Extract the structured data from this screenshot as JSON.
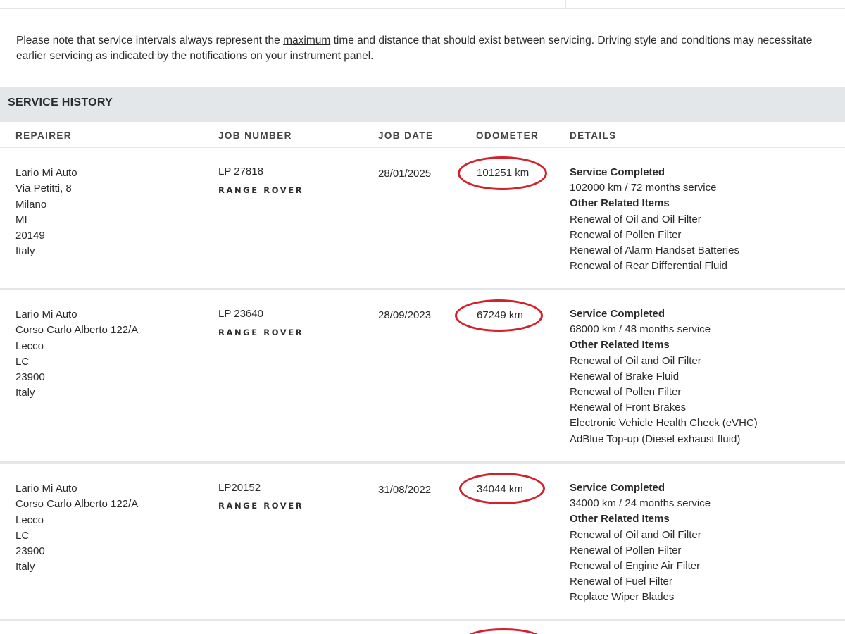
{
  "note": {
    "before": "Please note that service intervals always represent the ",
    "emph": "maximum",
    "after": " time and distance that should exist between servicing. Driving style and conditions may necessitate earlier servicing as indicated by the notifications on your instrument panel."
  },
  "section_title": "SERVICE HISTORY",
  "columns": {
    "repairer": "REPAIRER",
    "job_number": "JOB NUMBER",
    "job_date": "JOB DATE",
    "odometer": "ODOMETER",
    "details": "DETAILS"
  },
  "colors": {
    "highlight_ring": "#d4202a",
    "header_bg": "#e4e7e9"
  },
  "records": [
    {
      "repairer": [
        "Lario Mi Auto",
        "Via Petitti, 8",
        "Milano",
        "MI",
        "20149",
        "Italy"
      ],
      "job_number": "LP 27818",
      "brand": "RANGE ROVER",
      "job_date": "28/01/2025",
      "odometer": "101251 km",
      "details": {
        "heading": "Service Completed",
        "service": "102000 km / 72 months service",
        "other_heading": "Other Related Items",
        "items": [
          "Renewal of Oil and Oil Filter",
          "Renewal of Pollen Filter",
          "Renewal of Alarm Handset Batteries",
          "Renewal of Rear Differential Fluid"
        ]
      }
    },
    {
      "repairer": [
        "Lario Mi Auto",
        "Corso Carlo Alberto 122/A",
        "Lecco",
        "LC",
        "23900",
        "Italy"
      ],
      "job_number": "LP 23640",
      "brand": "RANGE ROVER",
      "job_date": "28/09/2023",
      "odometer": "67249 km",
      "details": {
        "heading": "Service Completed",
        "service": "68000 km / 48 months service",
        "other_heading": "Other Related Items",
        "items": [
          "Renewal of Oil and Oil Filter",
          "Renewal of Brake Fluid",
          "Renewal of Pollen Filter",
          "Renewal of Front Brakes",
          "Electronic Vehicle Health Check (eVHC)",
          "AdBlue Top-up (Diesel exhaust fluid)"
        ]
      }
    },
    {
      "repairer": [
        "Lario Mi Auto",
        "Corso Carlo Alberto 122/A",
        "Lecco",
        "LC",
        "23900",
        "Italy"
      ],
      "job_number": "LP20152",
      "brand": "RANGE ROVER",
      "job_date": "31/08/2022",
      "odometer": "34044 km",
      "details": {
        "heading": "Service Completed",
        "service": "34000 km / 24 months service",
        "other_heading": "Other Related Items",
        "items": [
          "Renewal of Oil and Oil Filter",
          "Renewal of Pollen Filter",
          "Renewal of Engine Air Filter",
          "Renewal of Fuel Filter",
          "Replace Wiper Blades"
        ]
      }
    }
  ]
}
